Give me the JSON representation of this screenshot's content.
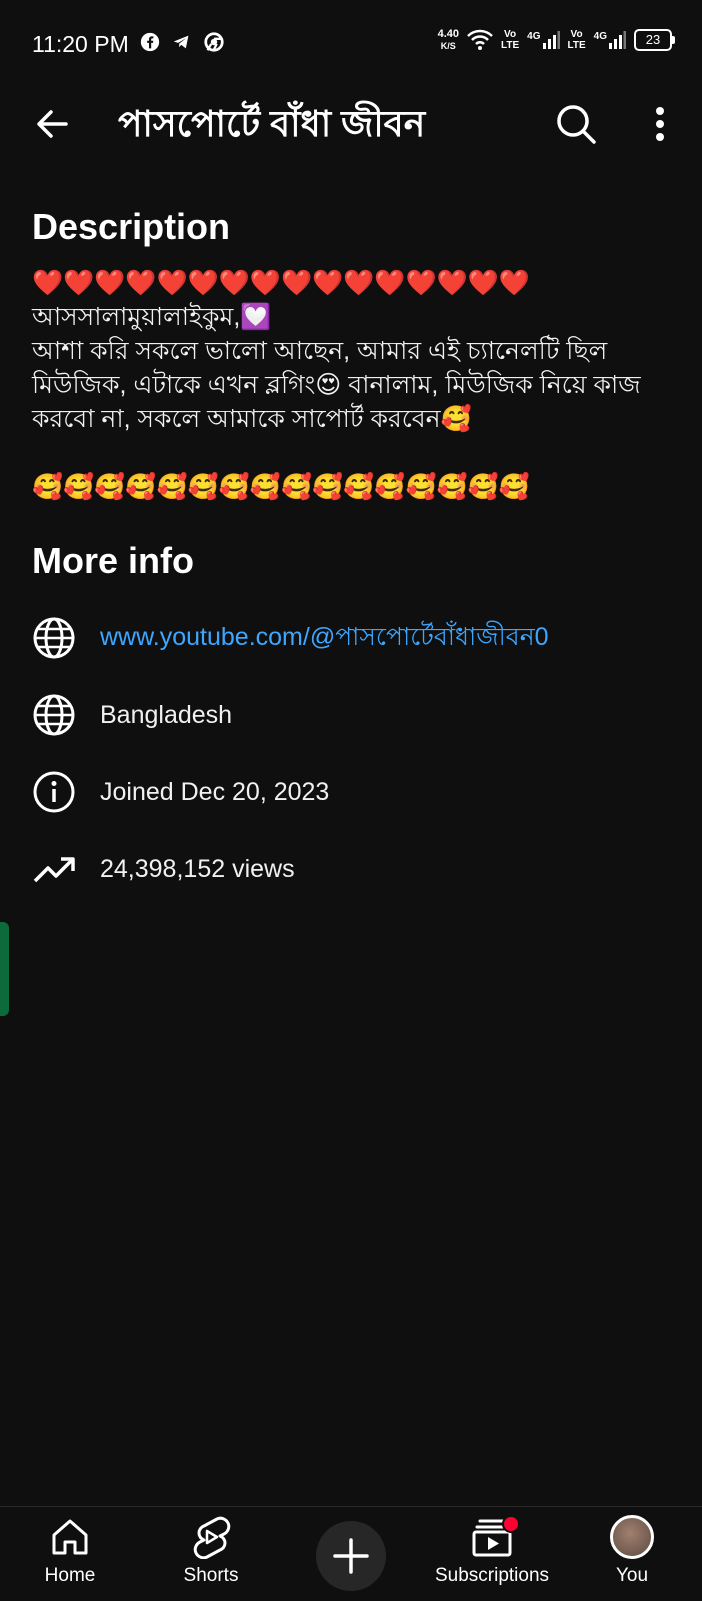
{
  "status_bar": {
    "time": "11:20 PM",
    "app_icons": [
      "facebook-icon",
      "telegram-icon",
      "chrome-icon"
    ],
    "net_speed_value": "4.40",
    "net_speed_unit": "K/S",
    "sim1_label_top": "Vo",
    "sim1_label_bottom": "LTE",
    "sim1_network": "4G",
    "sim2_label_top": "Vo",
    "sim2_label_bottom": "LTE",
    "sim2_network": "4G",
    "battery": "23"
  },
  "appbar": {
    "title": "পাসপোর্টে বাঁধা জীবন"
  },
  "description": {
    "heading": "Description",
    "body": "❤️❤️❤️❤️❤️❤️❤️❤️❤️❤️❤️❤️❤️❤️❤️❤️\nআসসালামুয়ালাইকুম,💟\nআশা করি সকলে ভালো আছেন, আমার এই চ্যানেলটি ছিল মিউজিক, এটাকে এখন ব্লগিং😍 বানালাম, মিউজিক নিয়ে কাজ করবো না, সকলে আমাকে সাপোর্ট করবেন🥰\n\n🥰🥰🥰🥰🥰🥰🥰🥰🥰🥰🥰🥰🥰🥰🥰🥰"
  },
  "more_info": {
    "heading": "More info",
    "link": "www.youtube.com/@পাসপোর্টেবাঁধাজীবন0",
    "country": "Bangladesh",
    "joined": "Joined Dec 20, 2023",
    "views": "24,398,152 views"
  },
  "bottom_nav": {
    "home": "Home",
    "shorts": "Shorts",
    "subscriptions": "Subscriptions",
    "you": "You"
  },
  "colors": {
    "background": "#0f0f0f",
    "link": "#3ea6ff",
    "notification": "#ff0033"
  }
}
